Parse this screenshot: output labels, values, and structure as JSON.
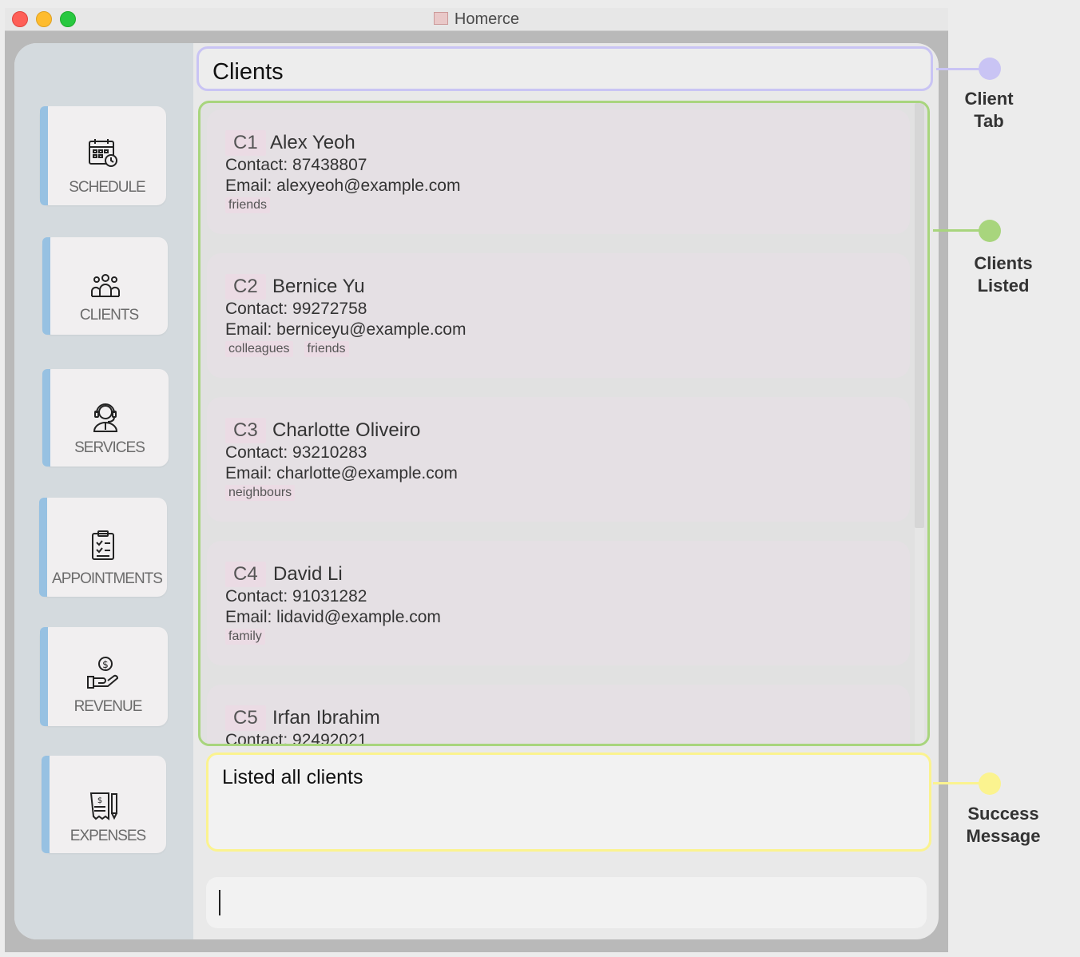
{
  "window": {
    "title": "Homerce"
  },
  "sidebar": {
    "items": [
      {
        "label": "SCHEDULE",
        "icon": "calendar-clock-icon"
      },
      {
        "label": "CLIENTS",
        "icon": "people-group-icon"
      },
      {
        "label": "SERVICES",
        "icon": "service-agent-icon"
      },
      {
        "label": "APPOINTMENTS",
        "icon": "clipboard-check-icon"
      },
      {
        "label": "REVENUE",
        "icon": "hand-money-icon"
      },
      {
        "label": "EXPENSES",
        "icon": "receipt-pen-icon"
      }
    ],
    "accent_color": "#97c1e2"
  },
  "header": {
    "title": "Clients"
  },
  "clients": [
    {
      "index": "C1",
      "name": "Alex Yeoh",
      "contact": "Contact: 87438807",
      "email": "Email: alexyeoh@example.com",
      "tags": [
        "friends"
      ]
    },
    {
      "index": "C2",
      "name": "Bernice Yu",
      "contact": "Contact: 99272758",
      "email": "Email: berniceyu@example.com",
      "tags": [
        "colleagues",
        "friends"
      ]
    },
    {
      "index": "C3",
      "name": "Charlotte Oliveiro",
      "contact": "Contact: 93210283",
      "email": "Email: charlotte@example.com",
      "tags": [
        "neighbours"
      ]
    },
    {
      "index": "C4",
      "name": "David Li",
      "contact": "Contact: 91031282",
      "email": "Email: lidavid@example.com",
      "tags": [
        "family"
      ]
    },
    {
      "index": "C5",
      "name": "Irfan Ibrahim",
      "contact": "Contact: 92492021",
      "email": "",
      "tags": []
    }
  ],
  "result": {
    "message": "Listed all clients"
  },
  "command": {
    "value": ""
  },
  "annotations": {
    "client_tab": {
      "line1": "Client",
      "line2": "Tab",
      "color": "#c9c4f4"
    },
    "clients_listed": {
      "line1": "Clients",
      "line2": "Listed",
      "color": "#a8d57d"
    },
    "success_message": {
      "line1": "Success",
      "line2": "Message",
      "color": "#fbf38f"
    }
  }
}
